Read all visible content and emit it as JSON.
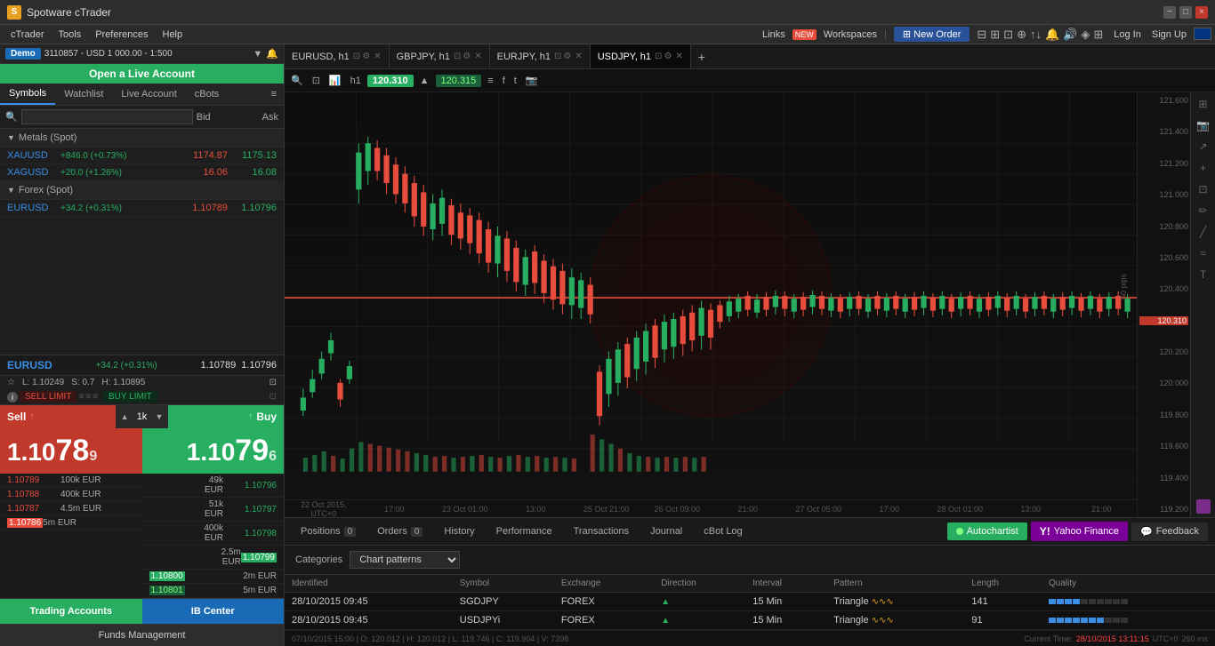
{
  "titlebar": {
    "title": "Spotware cTrader",
    "close_label": "×",
    "minimize_label": "−",
    "maximize_label": "□"
  },
  "menubar": {
    "items": [
      {
        "label": "cTrader",
        "id": "ctrader"
      },
      {
        "label": "Tools",
        "id": "tools"
      },
      {
        "label": "Preferences",
        "id": "preferences"
      },
      {
        "label": "Help",
        "id": "help"
      }
    ],
    "links_label": "Links",
    "new_badge": "NEW",
    "workspaces_label": "Workspaces",
    "new_order_label": "New Order",
    "log_in_label": "Log In",
    "sign_up_label": "Sign Up"
  },
  "account_bar": {
    "demo_label": "Demo",
    "account_id": "3110857",
    "currency": "USD",
    "balance": "1 000.00",
    "leverage": "1:500"
  },
  "live_banner": {
    "label": "Open a Live Account"
  },
  "left_tabs": {
    "tabs": [
      {
        "label": "Symbols",
        "active": true
      },
      {
        "label": "Watchlist",
        "active": false
      },
      {
        "label": "Live Account",
        "active": false
      },
      {
        "label": "cBots",
        "active": false
      }
    ]
  },
  "search": {
    "placeholder": "",
    "bid_label": "Bid",
    "ask_label": "Ask"
  },
  "groups": [
    {
      "name": "Metals (Spot)",
      "symbols": [
        {
          "name": "XAUUSD",
          "change": "+846.0 (+0.73%)",
          "bid": "1174.87",
          "ask": "1175.13"
        },
        {
          "name": "XAGUSD",
          "change": "+20.0 (+1.26%)",
          "bid": "16.06",
          "ask": "16.08"
        }
      ]
    },
    {
      "name": "Forex (Spot)",
      "symbols": [
        {
          "name": "EURUSD",
          "change": "+34.2 (+0.31%)",
          "bid": "1.10789",
          "ask": "1.10796"
        }
      ]
    }
  ],
  "trading": {
    "symbol": "EURUSD",
    "change": "+34.2 (+0.31%)",
    "price1": "1.10789",
    "price2": "1.10796",
    "low": "L: 1.10249",
    "spread": "S: 0.7",
    "high": "H: 1.10895",
    "sell_label": "Sell",
    "buy_label": "Buy",
    "quantity": "1k",
    "sell_price_main": "1.10",
    "sell_price_big": "78",
    "sell_price_sub": "9",
    "buy_price_main": "1.10",
    "buy_price_big": "79",
    "buy_price_sub": "6",
    "order_book_sell": [
      {
        "price": "1.10789",
        "vol": "100k EUR",
        "vol2": ""
      },
      {
        "price": "1.10788",
        "vol": "400k EUR",
        "vol2": ""
      },
      {
        "price": "1.10787",
        "vol": "4.5m EUR",
        "vol2": ""
      },
      {
        "price": "1.10786",
        "vol": "5m EUR",
        "vol2": ""
      }
    ],
    "order_book_buy": [
      {
        "price": "1.10800",
        "vol": "",
        "vol2": "2m EUR"
      },
      {
        "price": "1.10801",
        "vol": "",
        "vol2": "5m EUR"
      },
      {
        "price": "1.10796",
        "vol": "",
        "vol2": "49k EUR"
      },
      {
        "price": "1.10797",
        "vol": "",
        "vol2": "51k EUR"
      },
      {
        "price": "1.10798",
        "vol": "",
        "vol2": "400k EUR"
      },
      {
        "price": "1.10799",
        "vol": "",
        "vol2": "2.5m EUR"
      }
    ]
  },
  "bottom_left": {
    "trading_accounts_label": "Trading Accounts",
    "ib_center_label": "IB Center",
    "funds_label": "Funds Management"
  },
  "chart_tabs": [
    {
      "label": "EURUSD, h1",
      "active": false
    },
    {
      "label": "GBPJPY, h1",
      "active": false
    },
    {
      "label": "EURJPY, h1",
      "active": false
    },
    {
      "label": "USDJPY, h1",
      "active": true
    }
  ],
  "chart_toolbar": {
    "price1": "120.310",
    "price2": "120.315"
  },
  "price_levels": [
    "121.600",
    "121.400",
    "121.200",
    "121.000",
    "120.800",
    "120.600",
    "120.400",
    "120.200",
    "120.000",
    "119.800",
    "119.600",
    "119.400",
    "119.200"
  ],
  "current_price": "120.310",
  "pip_label": "50 pips",
  "time_labels": [
    "22 Oct 2015, UTC+0",
    "17:00",
    "23 Oct 01:00",
    "13:00",
    "25 Oct 21:00",
    "26 Oct 09:00",
    "21:00",
    "27 Oct 05:00",
    "17:00",
    "28 Oct 01:00",
    "13:00",
    "21:00"
  ],
  "bottom_tabs": [
    {
      "label": "Positions",
      "badge": "0",
      "active": false
    },
    {
      "label": "Orders",
      "badge": "0",
      "active": false
    },
    {
      "label": "History",
      "badge": null,
      "active": false
    },
    {
      "label": "Performance",
      "badge": null,
      "active": false
    },
    {
      "label": "Transactions",
      "badge": null,
      "active": false
    },
    {
      "label": "Journal",
      "badge": null,
      "active": false
    },
    {
      "label": "cBot Log",
      "badge": null,
      "active": false
    }
  ],
  "autochartist": {
    "button_label": "Autochartist",
    "yahoo_label": "Yahoo Finance",
    "feedback_label": "Feedback",
    "categories_label": "Categories",
    "categories_value": "Chart patterns",
    "columns": [
      "Identified",
      "Symbol",
      "Exchange",
      "Direction",
      "Interval",
      "Pattern",
      "Length",
      "Quality"
    ],
    "rows": [
      {
        "identified": "28/10/2015 09:45",
        "symbol": "SGDJPY",
        "exchange": "FOREX",
        "direction": "▲",
        "interval": "15 Min",
        "pattern": "Triangle",
        "length": "141",
        "quality": [
          1,
          1,
          1,
          1,
          0,
          0,
          0,
          0,
          0,
          0
        ]
      },
      {
        "identified": "28/10/2015 09:45",
        "symbol": "USDJPYi",
        "exchange": "FOREX",
        "direction": "▲",
        "interval": "15 Min",
        "pattern": "Triangle",
        "length": "91",
        "quality": [
          1,
          1,
          1,
          1,
          1,
          1,
          1,
          0,
          0,
          0
        ]
      }
    ]
  },
  "status_bar": {
    "left": "07/10/2015 15:00 | O: 120.012 | H: 120.012 | L: 119.746 | C: 119.904 | V: 7398",
    "time_label": "Current Time:",
    "time_value": "28/10/2015 13:11:15",
    "utc": "UTC+0",
    "pips": "260 ms"
  }
}
